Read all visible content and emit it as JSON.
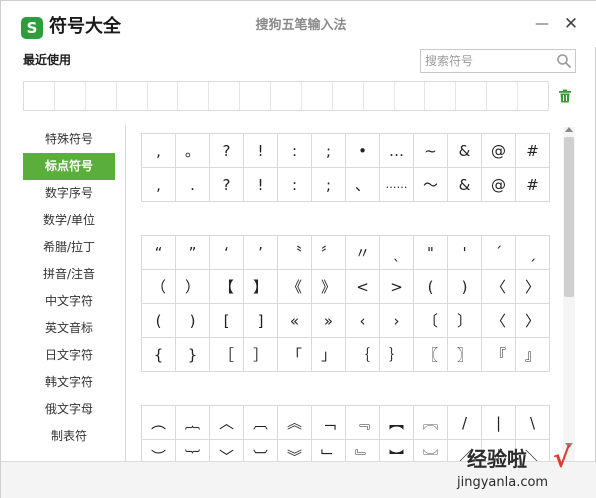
{
  "app": {
    "logo_letter": "S",
    "title": "符号大全",
    "window_title": "搜狗五笔输入法",
    "minimize_glyph": "—",
    "close_glyph": "✕"
  },
  "recent": {
    "label": "最近使用",
    "slots": 17
  },
  "search": {
    "placeholder": "搜索符号",
    "value": ""
  },
  "sidebar": {
    "items": [
      {
        "label": "特殊符号",
        "active": false
      },
      {
        "label": "标点符号",
        "active": true
      },
      {
        "label": "数字序号",
        "active": false
      },
      {
        "label": "数学/单位",
        "active": false
      },
      {
        "label": "希腊/拉丁",
        "active": false
      },
      {
        "label": "拼音/注音",
        "active": false
      },
      {
        "label": "中文字符",
        "active": false
      },
      {
        "label": "英文音标",
        "active": false
      },
      {
        "label": "日文字符",
        "active": false
      },
      {
        "label": "韩文字符",
        "active": false
      },
      {
        "label": "俄文字母",
        "active": false
      },
      {
        "label": "制表符",
        "active": false
      }
    ]
  },
  "symbol_groups": [
    {
      "rows": [
        [
          ",",
          "。",
          "?",
          "!",
          ":",
          ";",
          "•",
          "…",
          "~",
          "&",
          "@",
          "#"
        ],
        [
          ",",
          ".",
          "?",
          "!",
          ":",
          ";",
          "、",
          "……",
          "～",
          "&",
          "@",
          "#"
        ]
      ]
    },
    {
      "rows": [
        [
          "“",
          "”",
          "‘",
          "’",
          "〝",
          "〞",
          "〃",
          "ˎ",
          "\"",
          "'",
          "ˊ",
          "ˏ"
        ],
        [
          "（",
          "）",
          "【",
          "】",
          "《",
          "》",
          "<",
          ">",
          "(",
          ")",
          "〈",
          "〉"
        ],
        [
          "(",
          ")",
          "[",
          "]",
          "«",
          "»",
          "‹",
          "›",
          "〔",
          "〕",
          "〈",
          "〉"
        ],
        [
          "{",
          "}",
          "［",
          "］",
          "「",
          "」",
          "｛",
          "｝",
          "〖",
          "〗",
          "『",
          "』"
        ]
      ]
    },
    {
      "rows": [
        [
          "︵",
          "︷",
          "︿",
          "︹",
          "︽",
          "﹁",
          "﹃",
          "︻",
          "︗",
          "/",
          "|",
          "\\"
        ],
        [
          "︶",
          "︸",
          "﹀",
          "︺",
          "︾",
          "﹂",
          "﹄",
          "︼",
          "︘",
          "／",
          "｜",
          "＼"
        ]
      ]
    }
  ],
  "watermark": {
    "title": "经验啦",
    "url": "jingyanla.com",
    "check": "√"
  },
  "colors": {
    "accent": "#5aaf3c",
    "logo": "#2f9d3d",
    "watermark_check": "#e23b2e"
  }
}
